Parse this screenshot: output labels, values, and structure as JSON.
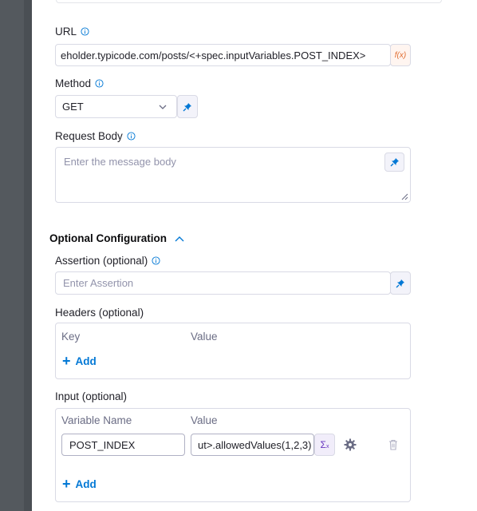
{
  "url": {
    "label": "URL",
    "value": "eholder.typicode.com/posts/<+spec.inputVariables.POST_INDEX>",
    "fx_label": "f(x)"
  },
  "method": {
    "label": "Method",
    "value": "GET"
  },
  "request_body": {
    "label": "Request Body",
    "placeholder": "Enter the message body"
  },
  "optional_config": {
    "title": "Optional Configuration",
    "assertion": {
      "label": "Assertion (optional)",
      "placeholder": "Enter Assertion"
    },
    "headers": {
      "label": "Headers (optional)",
      "key_header": "Key",
      "value_header": "Value",
      "add_label": "Add"
    },
    "input": {
      "label": "Input (optional)",
      "name_header": "Variable Name",
      "value_header": "Value",
      "rows": [
        {
          "name": "POST_INDEX",
          "value": "ut>.allowedValues(1,2,3)"
        }
      ],
      "add_label": "Add"
    }
  },
  "colors": {
    "accent": "#0278d5",
    "border": "#d9dae5",
    "sidebar": "#54595e"
  }
}
